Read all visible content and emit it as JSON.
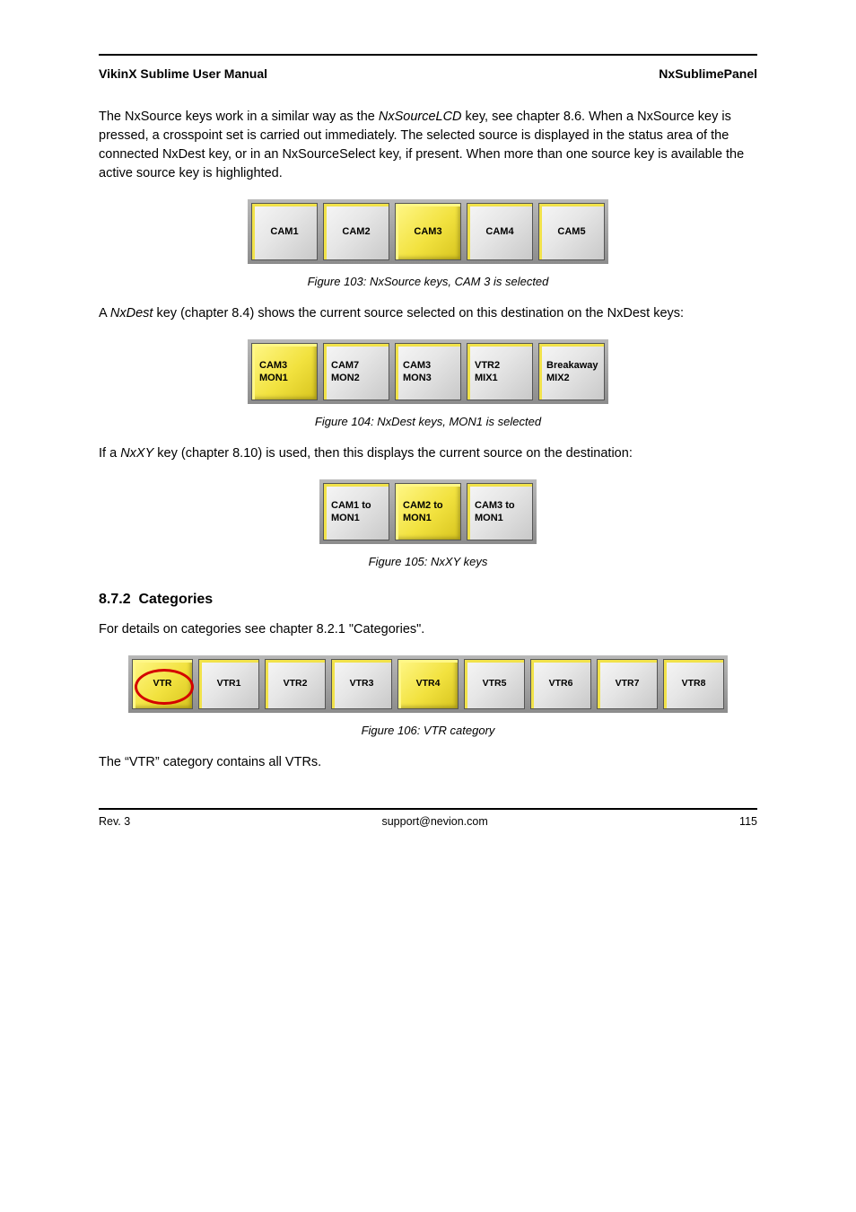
{
  "header": {
    "left": "VikinX Sublime User Manual",
    "right": "NxSublimePanel"
  },
  "para1_prefix": "The NxSource keys work in a similar way as the ",
  "para1_link1": "NxSourceLCD",
  "para1_suffix": " key, see chapter 8.6. When a NxSource key is pressed, a crosspoint set is carried out immediately. The selected source is displayed in the status area of the connected NxDest key, or in an NxSourceSelect key, if present. When more than one source key is available the active source key is highlighted.",
  "fig1": {
    "buttons": [
      {
        "label": "CAM1",
        "active": false
      },
      {
        "label": "CAM2",
        "active": false
      },
      {
        "label": "CAM3",
        "active": true
      },
      {
        "label": "CAM4",
        "active": false
      },
      {
        "label": "CAM5",
        "active": false
      }
    ],
    "caption": "Figure 103: NxSource keys, CAM 3 is selected"
  },
  "para2_prefix": "A ",
  "para2_link": "NxDest",
  "para2_mid": " key (chapter 8.4) shows the current source selected on this destination on the NxDest keys:",
  "fig2": {
    "buttons": [
      {
        "l1": "CAM3",
        "l2": "MON1",
        "active": true
      },
      {
        "l1": "CAM7",
        "l2": "MON2",
        "active": false
      },
      {
        "l1": "CAM3",
        "l2": "MON3",
        "active": false
      },
      {
        "l1": "VTR2",
        "l2": "MIX1",
        "active": false
      },
      {
        "l1": "Breakaway",
        "l2": "MIX2",
        "active": false
      }
    ],
    "caption": "Figure 104: NxDest keys, MON1 is selected"
  },
  "para3_prefix": "If a ",
  "para3_link": "NxXY",
  "para3_mid": " key (chapter 8.10) is used, then this displays the current source on the destination:",
  "fig3": {
    "buttons": [
      {
        "l1": "CAM1 to",
        "l2": "MON1",
        "active": false
      },
      {
        "l1": "CAM2 to",
        "l2": "MON1",
        "active": true
      },
      {
        "l1": "CAM3 to",
        "l2": "MON1",
        "active": false
      }
    ],
    "caption": "Figure 105: NxXY keys"
  },
  "section": {
    "num": "8.7.2",
    "title": "Categories"
  },
  "para4": "For details on categories see chapter 8.2.1 \"Categories\".",
  "fig4": {
    "buttons": [
      {
        "label": "VTR",
        "active": true,
        "circled": true
      },
      {
        "label": "VTR1",
        "active": false
      },
      {
        "label": "VTR2",
        "active": false
      },
      {
        "label": "VTR3",
        "active": false
      },
      {
        "label": "VTR4",
        "active": true
      },
      {
        "label": "VTR5",
        "active": false
      },
      {
        "label": "VTR6",
        "active": false
      },
      {
        "label": "VTR7",
        "active": false
      },
      {
        "label": "VTR8",
        "active": false
      }
    ],
    "caption": "Figure 106: VTR category"
  },
  "para5": "The “VTR” category contains all VTRs.",
  "footer": {
    "left": "Rev. 3",
    "center": "support@nevion.com",
    "right": "115"
  }
}
